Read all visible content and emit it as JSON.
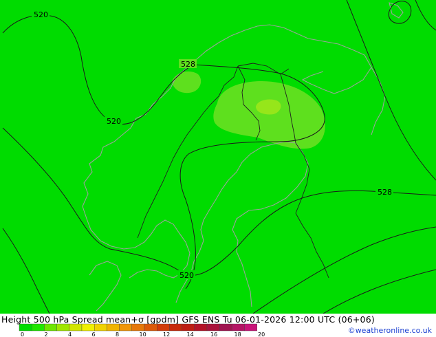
{
  "title": "Height 500 hPa Spread mean+σ [gpdm] GFS ENS Tu 06-01-2026 12:00 UTC (06+06)",
  "credit": "©weatheronline.co.uk",
  "contour_labels": [
    "520",
    "520",
    "520",
    "528",
    "528"
  ],
  "legend": {
    "colors": [
      "#00dc00",
      "#20e600",
      "#6ee600",
      "#a0e600",
      "#d2e600",
      "#f0f000",
      "#f0d200",
      "#f0b400",
      "#f0960a",
      "#e6780a",
      "#dc5a0a",
      "#d23c0a",
      "#c8280a",
      "#be1e14",
      "#b41428",
      "#aa143c",
      "#a01450",
      "#b41464",
      "#c81478"
    ],
    "ticks": [
      "0",
      "2",
      "4",
      "6",
      "8",
      "10",
      "12",
      "14",
      "16",
      "18",
      "20"
    ]
  },
  "colors": {
    "sea_field": "#00dc00",
    "spread_low": "#5ee01e",
    "spread_mid": "#76e41a",
    "spread_high": "#96e61a",
    "contour": "#1a1a1a",
    "coast": "#9aa39a",
    "border": "#202020"
  }
}
